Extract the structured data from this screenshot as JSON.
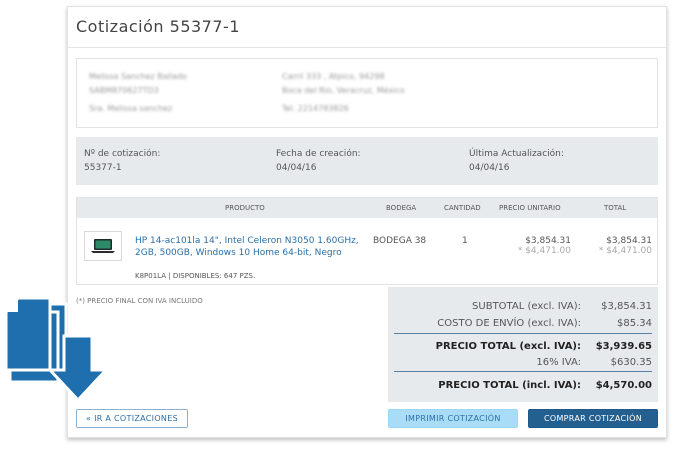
{
  "quote": {
    "title": "Cotización 55377-1"
  },
  "address": {
    "left": [
      "Melissa Sanchez Ballado",
      "SABM870627TD3",
      "Sra. Melissa sanchez"
    ],
    "right": [
      "Carril 333 , Atpico, 94298",
      "Boca del Rio, Veracruz, México",
      "Tel. 2214783826"
    ]
  },
  "meta": {
    "number_label": "Nº de cotización:",
    "number_value": "55377-1",
    "created_label": "Fecha de creación:",
    "created_value": "04/04/16",
    "updated_label": "Última Actualización:",
    "updated_value": "04/04/16"
  },
  "table": {
    "headers": {
      "product": "PRODUCTO",
      "warehouse": "BODEGA",
      "quantity": "CANTIDAD",
      "unit_price": "PRECIO UNITARIO",
      "total": "TOTAL"
    },
    "rows": [
      {
        "name": "HP 14-ac101la 14\", Intel Celeron N3050 1.60GHz, 2GB, 500GB, Windows 10 Home 64-bit, Negro",
        "sku_stock": "K8P01LA | DISPONIBLES: 647 PZS.",
        "warehouse": "BODEGA 38",
        "quantity": "1",
        "unit_price": "$3,854.31",
        "unit_price_iva": "* $4,471.00",
        "total": "$3,854.31",
        "total_iva": "* $4,471.00"
      }
    ]
  },
  "footnote": "(*) PRECIO FINAL CON IVA INCLUIDO",
  "totals": {
    "subtotal_label": "SUBTOTAL (excl. IVA):",
    "subtotal_value": "$3,854.31",
    "shipping_label": "COSTO DE ENVÍO (excl. IVA):",
    "shipping_value": "$85.34",
    "total_excl_label": "PRECIO TOTAL (excl. IVA):",
    "total_excl_value": "$3,939.65",
    "iva_label": "16% IVA:",
    "iva_value": "$630.35",
    "total_incl_label": "PRECIO TOTAL (incl. IVA):",
    "total_incl_value": "$4,570.00"
  },
  "actions": {
    "back": "« IR A COTIZACIONES",
    "print": "IMPRIMIR COTIZACIÓN",
    "buy": "COMPRAR COTIZACIÓN"
  },
  "colors": {
    "accent": "#24608f",
    "link": "#2a6fa8",
    "icon": "#1f6fae",
    "panel": "#e7eaed"
  }
}
